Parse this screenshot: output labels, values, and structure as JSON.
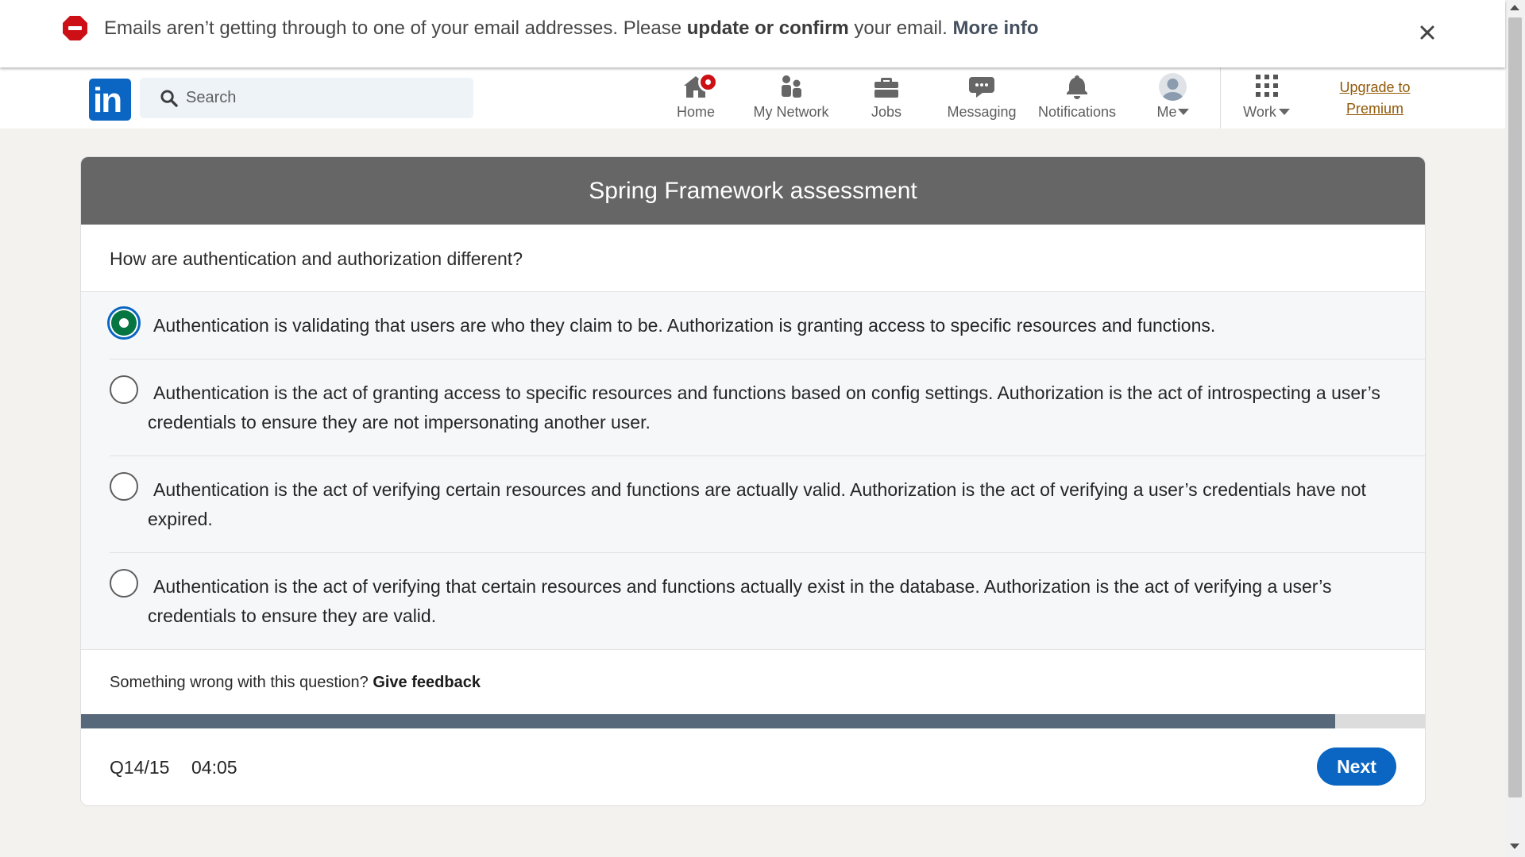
{
  "banner": {
    "text_before": "Emails aren’t getting through to one of your email addresses. Please ",
    "bold_text": "update or confirm",
    "text_after": " your email. ",
    "link": "More info"
  },
  "nav": {
    "logo": "in",
    "search_placeholder": "Search",
    "items": [
      {
        "label": "Home",
        "icon": "home-icon"
      },
      {
        "label": "My Network",
        "icon": "network-icon"
      },
      {
        "label": "Jobs",
        "icon": "briefcase-icon"
      },
      {
        "label": "Messaging",
        "icon": "messaging-icon"
      },
      {
        "label": "Notifications",
        "icon": "bell-icon"
      },
      {
        "label": "Me",
        "icon": "avatar"
      },
      {
        "label": "Work",
        "icon": "grid-icon"
      }
    ],
    "premium_line1": "Upgrade to",
    "premium_line2": "Premium"
  },
  "assessment": {
    "title": "Spring Framework assessment",
    "question": "How are authentication and authorization different?",
    "options": [
      {
        "text": "Authentication is validating that users are who they claim to be. Authorization is granting access to specific resources and functions.",
        "selected": true
      },
      {
        "text": "Authentication is the act of granting access to specific resources and functions based on config settings. Authorization is the act of introspecting a user’s credentials to ensure they are not impersonating another user.",
        "selected": false
      },
      {
        "text": "Authentication is the act of verifying certain resources and functions are actually valid. Authorization is the act of verifying a user’s credentials have not expired.",
        "selected": false
      },
      {
        "text": "Authentication is the act of verifying that certain resources and functions actually exist in the database. Authorization is the act of verifying a user’s credentials to ensure they are valid.",
        "selected": false
      }
    ],
    "feedback_prefix": "Something wrong with this question?",
    "feedback_link": "Give feedback",
    "progress": 0.933,
    "question_counter": "Q14/15",
    "timer": "04:05",
    "next_label": "Next"
  },
  "colors": {
    "brand": "#0a66c2",
    "selected_radio": "#057642",
    "header": "#666666",
    "progress_fill": "#56687a",
    "alert": "#cc1016",
    "premium": "#915907"
  }
}
